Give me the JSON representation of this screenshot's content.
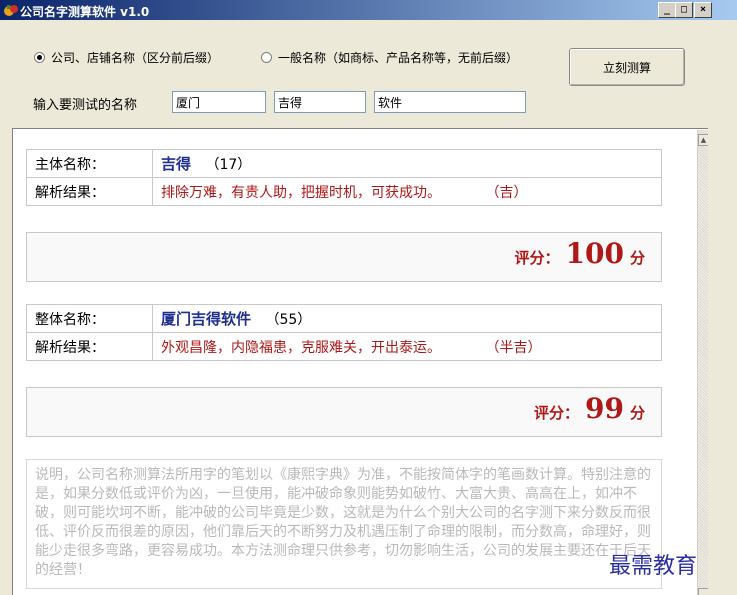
{
  "window": {
    "title": "公司名字测算软件 v1.0",
    "min": "_",
    "max": "□",
    "close": "×"
  },
  "options": {
    "radio1": "公司、店铺名称（区分前后缀）",
    "radio2": "一般名称（如商标、产品名称等，无前后缀）",
    "radio1_checked": true
  },
  "calc_button": "立刻测算",
  "input": {
    "label": "输入要测试的名称",
    "prefix": "厦门",
    "main": "吉得",
    "suffix": "软件"
  },
  "main_result": {
    "label": "主体名称：",
    "name": "吉得",
    "count": "（17）",
    "analysis_label": "解析结果：",
    "analysis": "排除万难，有贵人助，把握时机，可获成功。",
    "fortune": "（吉）",
    "score_label": "评分：",
    "score": "100",
    "score_unit": "分"
  },
  "full_result": {
    "label": "整体名称：",
    "name": "厦门吉得软件",
    "count": "（55）",
    "analysis_label": "解析结果：",
    "analysis": "外观昌隆，内隐福患，克服难关，开出泰运。",
    "fortune": "（半吉）",
    "score_label": "评分：",
    "score": "99",
    "score_unit": "分"
  },
  "note": "说明，公司名称测算法所用字的笔划以《康熙字典》为准，不能按简体字的笔画数计算。特别注意的是，如果分数低或评价为凶，一旦使用，能冲破命象则能势如破竹、大富大贵、高高在上，如冲不破，则可能坎坷不断，能冲破的公司毕竟是少数，这就是为什么个别大公司的名字测下来分数反而很低、评价反而很差的原因，他们靠后天的不断努力及机遇压制了命理的限制，而分数高，命理好，则能少走很多弯路，更容易成功。本方法测命理只供参考，切勿影响生活，公司的发展主要还在于后天的经营！",
  "watermark": "最需教育"
}
